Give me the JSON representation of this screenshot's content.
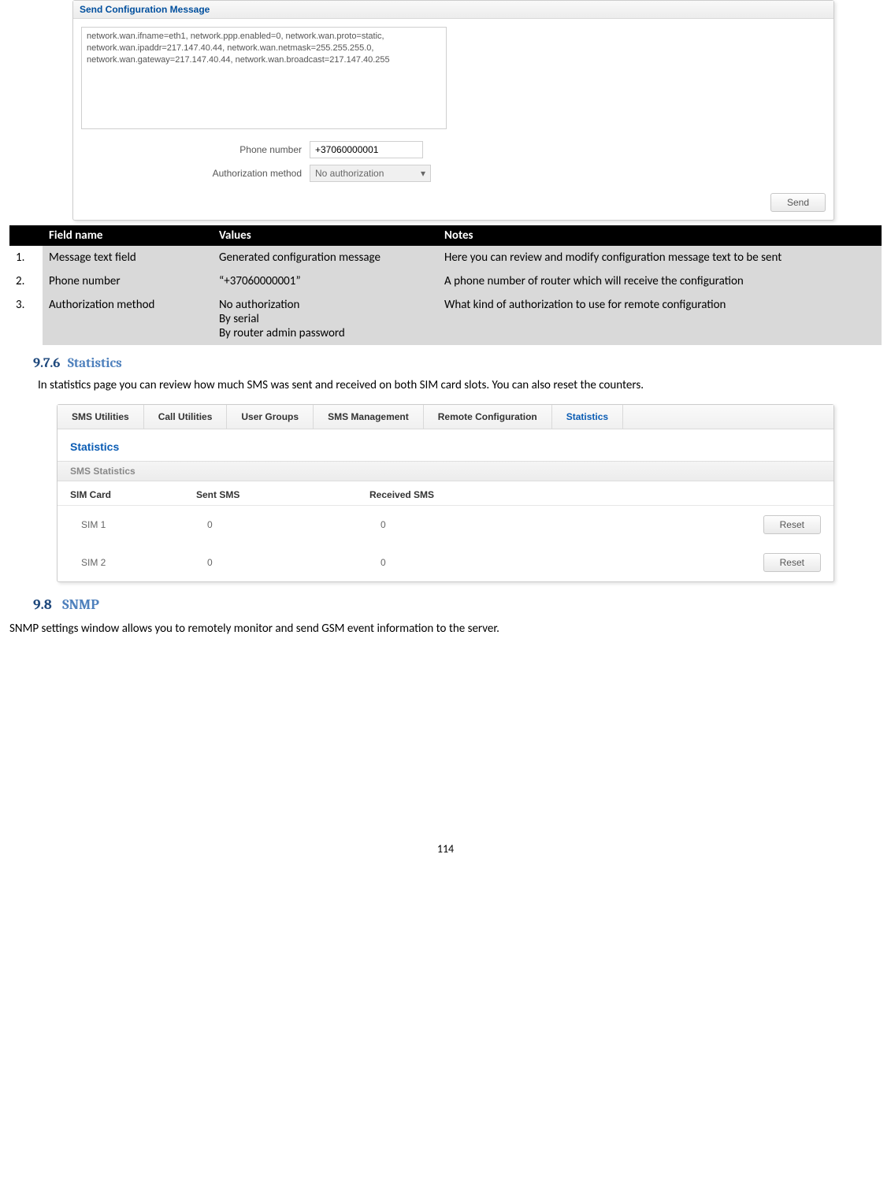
{
  "shot1": {
    "title": "Send Configuration Message",
    "message_text": "network.wan.ifname=eth1, network.ppp.enabled=0, network.wan.proto=static, network.wan.ipaddr=217.147.40.44, network.wan.netmask=255.255.255.0, network.wan.gateway=217.147.40.44, network.wan.broadcast=217.147.40.255",
    "phone_label": "Phone number",
    "phone_value": "+37060000001",
    "auth_label": "Authorization method",
    "auth_value": "No authorization",
    "send_label": "Send"
  },
  "defs_header": {
    "col1": "",
    "col2": "Field name",
    "col3": "Values",
    "col4": "Notes"
  },
  "defs": [
    {
      "n": "1.",
      "field": "Message text field",
      "values": "Generated configuration message",
      "notes": "Here you can review and modify configuration message text to be sent"
    },
    {
      "n": "2.",
      "field": "Phone number",
      "values": "“+37060000001”",
      "notes": "A phone number of router which will receive the configuration"
    },
    {
      "n": "3.",
      "field": "Authorization method",
      "values": "No authorization\nBy serial\nBy router admin password",
      "notes": "What kind of authorization to use for remote configuration"
    }
  ],
  "sec976": {
    "num": "9.7.6",
    "title": "Statistics"
  },
  "stats_para": "In statistics page you can review how much SMS was sent and received on both SIM card slots. You can also reset the counters.",
  "shot2": {
    "tabs": [
      "SMS Utilities",
      "Call Utilities",
      "User Groups",
      "SMS Management",
      "Remote Configuration",
      "Statistics"
    ],
    "active_tab_index": 5,
    "heading": "Statistics",
    "sub": "SMS Statistics",
    "columns": {
      "c1": "SIM Card",
      "c2": "Sent SMS",
      "c3": "Received SMS"
    },
    "rows": [
      {
        "sim": "SIM 1",
        "sent": "0",
        "recv": "0",
        "btn": "Reset"
      },
      {
        "sim": "SIM 2",
        "sent": "0",
        "recv": "0",
        "btn": "Reset"
      }
    ]
  },
  "chart_data": {
    "type": "table",
    "title": "SMS Statistics",
    "columns": [
      "SIM Card",
      "Sent SMS",
      "Received SMS"
    ],
    "rows": [
      [
        "SIM 1",
        0,
        0
      ],
      [
        "SIM 2",
        0,
        0
      ]
    ]
  },
  "sec98": {
    "num": "9.8",
    "title": "SNMP"
  },
  "snmp_para": "SNMP settings window allows you to remotely monitor and send GSM event information to the server.",
  "page_number": "114"
}
